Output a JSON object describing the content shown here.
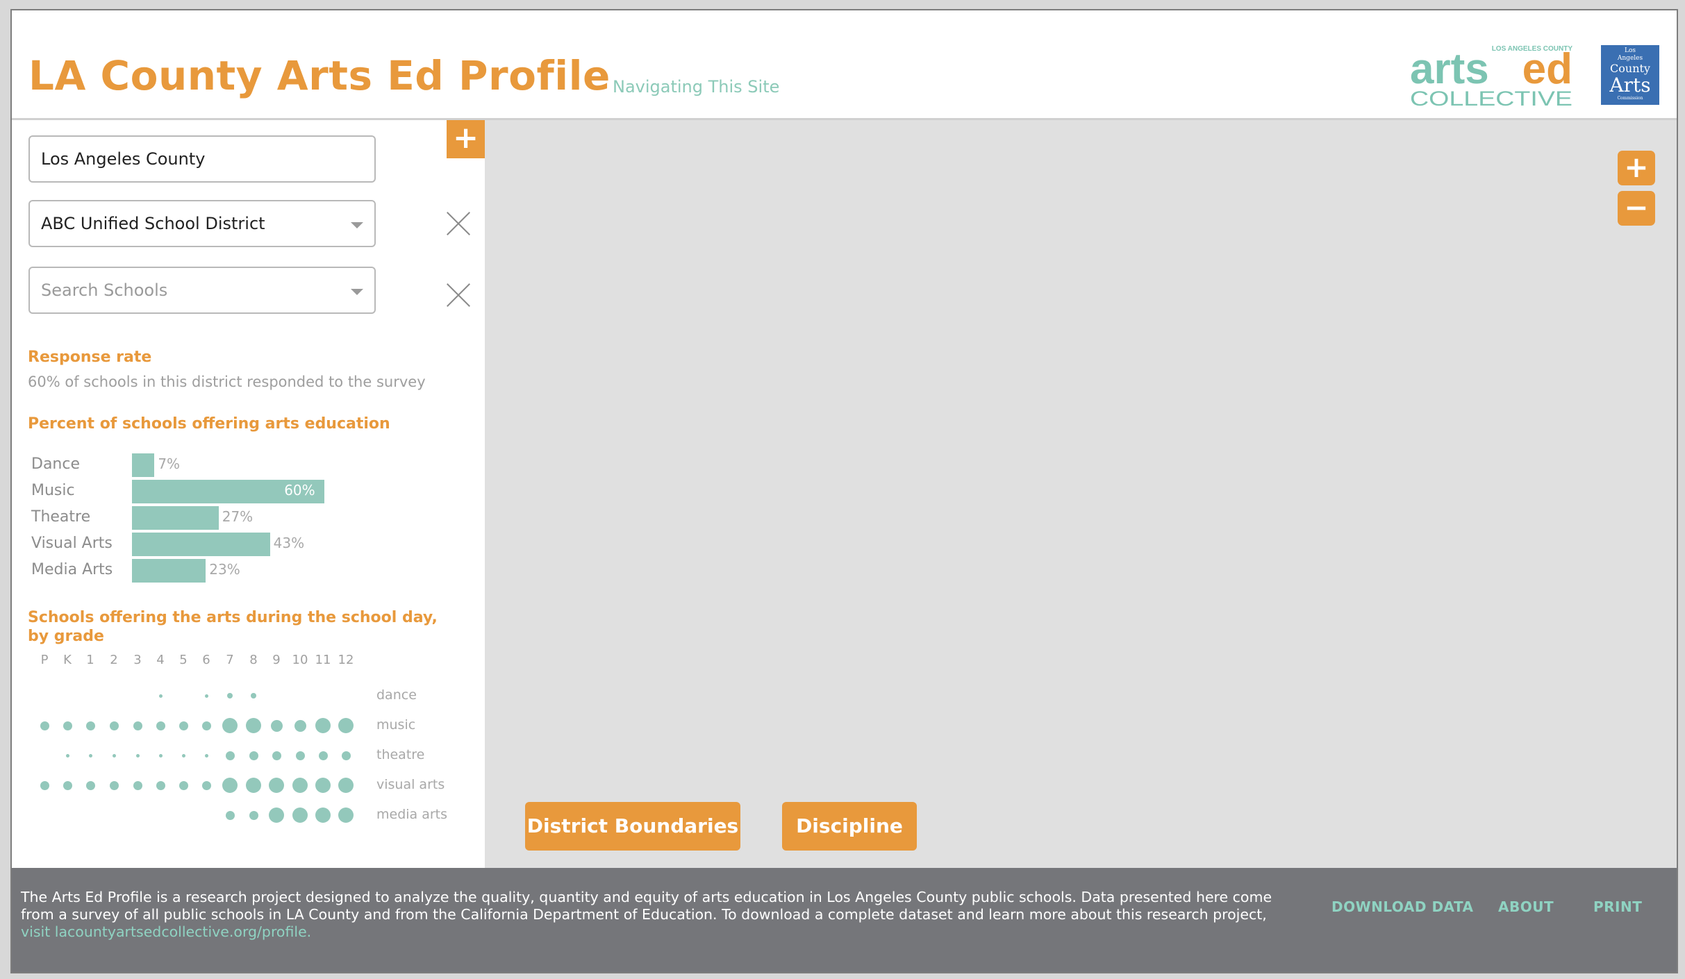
{
  "header": {
    "title": "LA County Arts Ed Profile",
    "nav_link": "Navigating This Site",
    "logo_artsed": {
      "top_text": "LOS ANGELES COUNTY",
      "arts": "arts",
      "ed": "ed",
      "bottom": "COLLECTIVE"
    },
    "logo_commission": {
      "line1": "Los",
      "line2": "Angeles",
      "line3": "County",
      "line4": "Arts",
      "line5": "Commission"
    }
  },
  "sidebar": {
    "add_button": "+",
    "county_select": "Los Angeles County",
    "district_select": "ABC Unified School District",
    "school_search": {
      "placeholder": "Search Schools"
    },
    "response_rate": {
      "heading": "Response rate",
      "text": "60% of schools in this district responded to the survey"
    },
    "bar_section_heading": "Percent of schools offering arts education",
    "grade_section_heading": "Schools offering the arts during the school day, by grade"
  },
  "chart_data": [
    {
      "type": "bar",
      "title": "Percent of schools offering arts education",
      "categories": [
        "Dance",
        "Music",
        "Theatre",
        "Visual Arts",
        "Media Arts"
      ],
      "values": [
        7,
        60,
        27,
        43,
        23
      ],
      "value_labels": [
        "7%",
        "60%",
        "27%",
        "43%",
        "23%"
      ],
      "orientation": "horizontal",
      "color": "#93c8bb"
    },
    {
      "type": "scatter",
      "title": "Schools offering the arts during the school day, by grade",
      "grades": [
        "P",
        "K",
        "1",
        "2",
        "3",
        "4",
        "5",
        "6",
        "7",
        "8",
        "9",
        "10",
        "11",
        "12"
      ],
      "series": [
        {
          "name": "dance",
          "sizes": [
            0,
            0,
            0,
            0,
            0,
            1,
            0,
            1,
            2,
            2,
            0,
            0,
            0,
            0
          ]
        },
        {
          "name": "music",
          "sizes": [
            3,
            3,
            3,
            3,
            3,
            3,
            3,
            3,
            5,
            5,
            4,
            4,
            5,
            5
          ]
        },
        {
          "name": "theatre",
          "sizes": [
            0,
            1,
            1,
            1,
            1,
            1,
            1,
            1,
            3,
            3,
            3,
            3,
            3,
            3
          ]
        },
        {
          "name": "visual arts",
          "sizes": [
            3,
            3,
            3,
            3,
            3,
            3,
            3,
            3,
            5,
            5,
            5,
            5,
            5,
            5
          ]
        },
        {
          "name": "media arts",
          "sizes": [
            0,
            0,
            0,
            0,
            0,
            0,
            0,
            0,
            3,
            3,
            5,
            5,
            5,
            5
          ]
        }
      ],
      "color": "#93c8bb"
    }
  ],
  "map": {
    "zoom_in": "+",
    "zoom_out": "−",
    "toggle_district": "District Boundaries",
    "toggle_discipline": "Discipline"
  },
  "footer": {
    "text": "The Arts Ed Profile is a research project designed to analyze the quality, quantity and equity of arts education in Los Angeles County public schools. Data presented here come from a survey of all public schools in LA County and from the California Department of Education. To download a complete dataset and learn more about this research project,",
    "link": "visit lacountyartsedcollective.org/profile.",
    "nav": [
      "DOWNLOAD DATA",
      "ABOUT",
      "PRINT"
    ]
  },
  "colors": {
    "accent": "#e8993c",
    "teal": "#93c8bb",
    "footer_bg": "#75767a",
    "map_bg": "#e0e0e0"
  }
}
